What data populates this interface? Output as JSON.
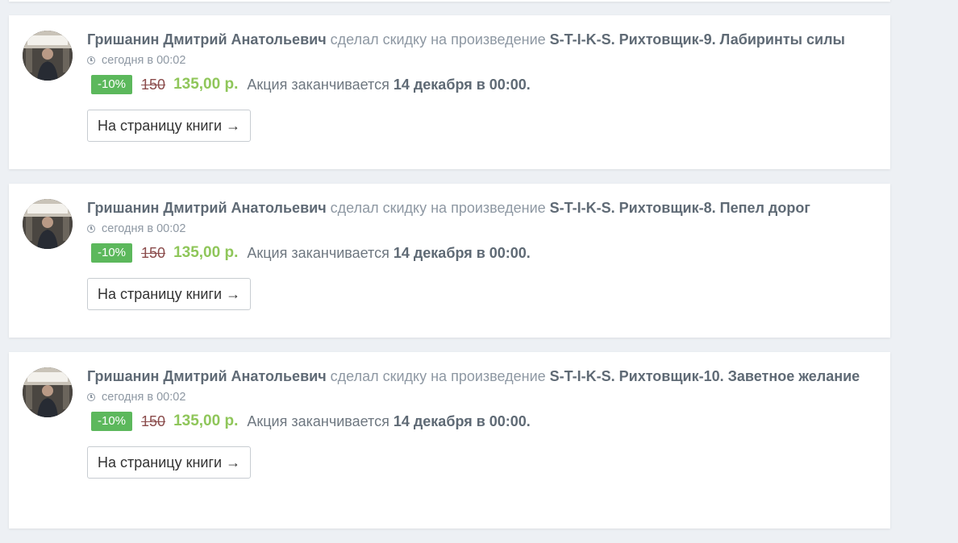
{
  "feed": {
    "items": [
      {
        "author": "Гришанин Дмитрий Анатольевич",
        "action": "сделал скидку на произведение",
        "work_title": "S-T-I-K-S. Рихтовщик-9. Лабиринты силы",
        "timestamp": "сегодня в 00:02",
        "discount": "-10%",
        "old_price": "150",
        "new_price": "135,00 р.",
        "promo_text": "Акция заканчивается",
        "promo_end": "14 декабря в 00:00.",
        "button_label": "На страницу книги →"
      },
      {
        "author": "Гришанин Дмитрий Анатольевич",
        "action": "сделал скидку на произведение",
        "work_title": "S-T-I-K-S. Рихтовщик-8. Пепел дорог",
        "timestamp": "сегодня в 00:02",
        "discount": "-10%",
        "old_price": "150",
        "new_price": "135,00 р.",
        "promo_text": "Акция заканчивается",
        "promo_end": "14 декабря в 00:00.",
        "button_label": "На страницу книги →"
      },
      {
        "author": "Гришанин Дмитрий Анатольевич",
        "action": "сделал скидку на произведение",
        "work_title": "S-T-I-K-S. Рихтовщик-10. Заветное желание",
        "timestamp": "сегодня в 00:02",
        "discount": "-10%",
        "old_price": "150",
        "new_price": "135,00 р.",
        "promo_text": "Акция заканчивается",
        "promo_end": "14 декабря в 00:00.",
        "button_label": "На страницу книги →"
      }
    ]
  },
  "colors": {
    "background": "#edf0f4",
    "badge": "#5cb85c",
    "new_price": "#8fc65a",
    "old_price": "#8b4c4c"
  },
  "icons": {
    "timestamp": "clock-icon"
  }
}
